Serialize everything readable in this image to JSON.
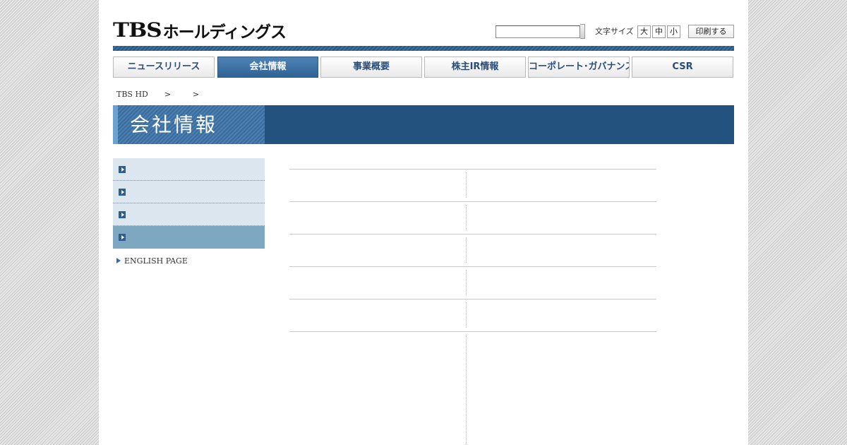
{
  "header": {
    "logo_main": "TBS",
    "logo_sub": "ホールディングス",
    "search": {
      "value": "",
      "placeholder": ""
    },
    "font_size_label": "文字サイズ",
    "font_size_buttons": [
      "大",
      "中",
      "小"
    ],
    "print_label": "印刷する"
  },
  "nav": {
    "items": [
      {
        "label": "ニュースリリース",
        "active": false
      },
      {
        "label": "会社情報",
        "active": true
      },
      {
        "label": "事業概要",
        "active": false
      },
      {
        "label": "株主IR情報",
        "active": false
      },
      {
        "label": "コーポレート･ガバナンス",
        "active": false
      },
      {
        "label": "CSR",
        "active": false
      }
    ]
  },
  "breadcrumb": {
    "home": "TBS HD",
    "separators": [
      ">",
      ">"
    ]
  },
  "banner": {
    "title": "会社情報"
  },
  "sidebar": {
    "items": [
      {
        "label": "",
        "active": false
      },
      {
        "label": "",
        "active": false
      },
      {
        "label": "",
        "active": false
      },
      {
        "label": "",
        "active": true
      }
    ],
    "english_link": "ENGLISH PAGE"
  },
  "content": {
    "rows": [
      {
        "left": "",
        "right": ""
      },
      {
        "left": "",
        "right": ""
      },
      {
        "left": "",
        "right": ""
      },
      {
        "left": "",
        "right": ""
      },
      {
        "left": "",
        "right": ""
      }
    ]
  },
  "colors": {
    "brand_dark": "#23527f",
    "nav_text": "#2a4d77",
    "sidebar_bg": "#dce6ee",
    "sidebar_active": "#7ea8c2"
  }
}
